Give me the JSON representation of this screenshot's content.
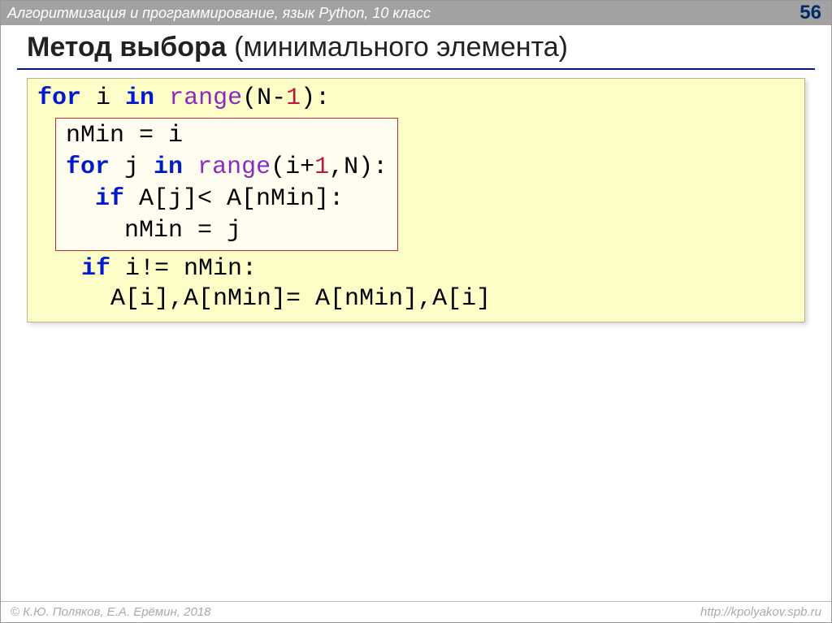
{
  "header": {
    "course": "Алгоритмизация и программирование, язык Python, 10 класс",
    "page": "56"
  },
  "title": {
    "bold": "Метод выбора",
    "rest": " (минимального элемента)"
  },
  "code": {
    "l1_for": "for",
    "l1_mid": " i ",
    "l1_in": "in",
    "l1_sp": " ",
    "l1_range": "range",
    "l1_open": "(N-",
    "l1_one": "1",
    "l1_close": "):",
    "inner_l1": "nMin = i",
    "inner_l2_for": "for",
    "inner_l2_mid": " j ",
    "inner_l2_in": "in",
    "inner_l2_sp": " ",
    "inner_l2_range": "range",
    "inner_l2_open": "(i+",
    "inner_l2_one": "1",
    "inner_l2_close": ",N):",
    "inner_l3_indent": "  ",
    "inner_l3_if": "if",
    "inner_l3_rest": " A[j]< A[nMin]:",
    "inner_l4": "    nMin = j",
    "l5_indent": "   ",
    "l5_if": "if",
    "l5_rest": " i!= nMin:",
    "l6": "     A[i],A[nMin]= A[nMin],A[i]"
  },
  "footer": {
    "left": "К.Ю. Поляков, Е.А. Ерёмин, 2018",
    "right": "http://kpolyakov.spb.ru"
  }
}
